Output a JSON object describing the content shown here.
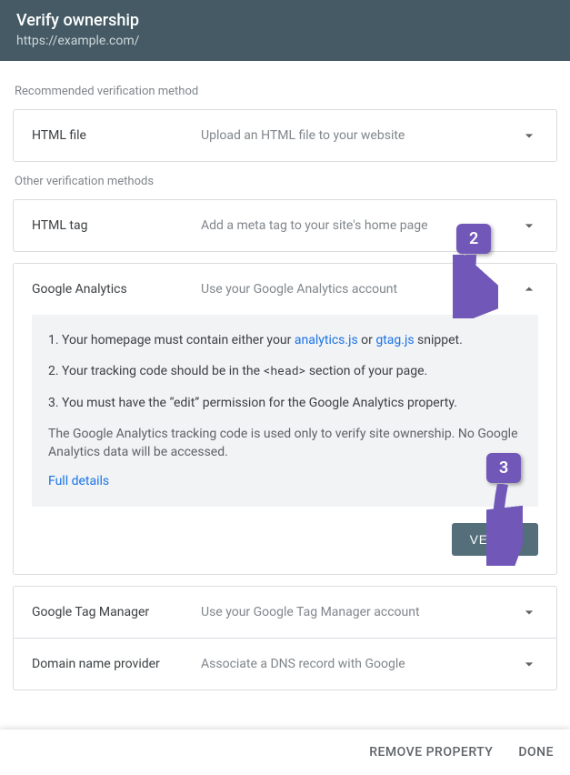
{
  "header": {
    "title": "Verify ownership",
    "url": "https://example.com/"
  },
  "labels": {
    "recommended": "Recommended verification method",
    "other": "Other verification methods"
  },
  "html_file": {
    "title": "HTML file",
    "desc": "Upload an HTML file to your website"
  },
  "html_tag": {
    "title": "HTML tag",
    "desc": "Add a meta tag to your site's home page"
  },
  "ga": {
    "title": "Google Analytics",
    "desc": "Use your Google Analytics account",
    "step1_a": "1. Your homepage must contain either your ",
    "step1_link1": "analytics.js",
    "step1_b": " or ",
    "step1_link2": "gtag.js",
    "step1_c": " snippet.",
    "step2_a": "2. Your tracking code should be in the ",
    "step2_code": "<head>",
    "step2_b": " section of your page.",
    "step3": "3. You must have the “edit” permission for the Google Analytics property.",
    "note": "The Google Analytics tracking code is used only to verify site ownership. No Google Analytics data will be accessed.",
    "details": "Full details",
    "verify": "VERIFY"
  },
  "gtm": {
    "title": "Google Tag Manager",
    "desc": "Use your Google Tag Manager account"
  },
  "dns": {
    "title": "Domain name provider",
    "desc": "Associate a DNS record with Google"
  },
  "footer": {
    "remove": "REMOVE PROPERTY",
    "done": "DONE"
  },
  "anno": {
    "two": "2",
    "three": "3"
  }
}
